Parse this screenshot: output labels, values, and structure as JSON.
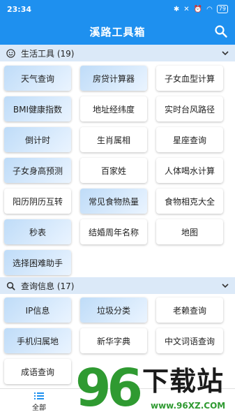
{
  "status": {
    "time": "23:34",
    "battery": "79"
  },
  "header": {
    "title": "溪路工具箱"
  },
  "sections": [
    {
      "title": "生活工具 (19)",
      "tiles": [
        "天气查询",
        "房贷计算器",
        "子女血型计算",
        "BMI健康指数",
        "地址经纬度",
        "实时台风路径",
        "倒计时",
        "生肖属相",
        "星座查询",
        "子女身高预测",
        "百家姓",
        "人体喝水计算",
        "阳历阴历互转",
        "常见食物热量",
        "食物相克大全",
        "秒表",
        "结婚周年名称",
        "地图",
        "选择困难助手"
      ]
    },
    {
      "title": "查询信息 (17)",
      "tiles": [
        "IP信息",
        "垃圾分类",
        "老赖查询",
        "手机归属地",
        "新华字典",
        "中文词语查询",
        "成语查询"
      ]
    }
  ],
  "bottom": {
    "tab_label": "全部"
  },
  "watermark": {
    "number": "96",
    "text": "下载站",
    "url": "www.96XZ.COM"
  },
  "colors": {
    "primary": "#1e90ef",
    "section_bg": "#dbe9f8",
    "tile_blue": "#bfdcf8",
    "watermark_green": "#2f9a31"
  }
}
